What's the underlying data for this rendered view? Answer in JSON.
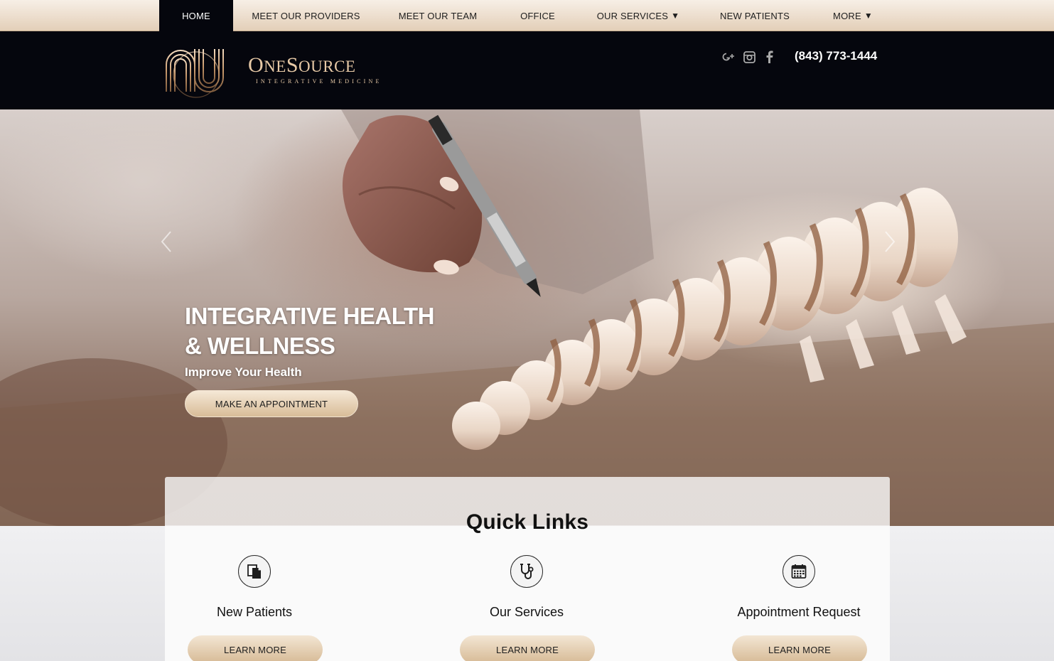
{
  "nav": {
    "items": [
      {
        "label": "HOME",
        "active": true
      },
      {
        "label": "MEET OUR PROVIDERS"
      },
      {
        "label": "MEET OUR TEAM"
      },
      {
        "label": "OFFICE"
      },
      {
        "label": "OUR SERVICES",
        "caret": "▼"
      },
      {
        "label": "NEW PATIENTS"
      },
      {
        "label": "MORE",
        "caret": "▼"
      }
    ]
  },
  "header": {
    "logo_name_first": "O",
    "logo_name_mid": "NE",
    "logo_name_s": "S",
    "logo_name_rest": "OURCE",
    "logo_sub": "INTEGRATIVE MEDICINE",
    "phone": "(843) 773-1444",
    "social_icons": [
      "google-plus-icon",
      "instagram-icon",
      "facebook-icon"
    ]
  },
  "hero": {
    "title": "INTEGRATIVE HEALTH & WELLNESS",
    "subtitle": "Improve Your Health",
    "cta": "MAKE AN APPOINTMENT"
  },
  "quick_links": {
    "title": "Quick Links",
    "items": [
      {
        "label": "New Patients",
        "icon": "documents-icon",
        "button": "LEARN MORE"
      },
      {
        "label": "Our Services",
        "icon": "stethoscope-icon",
        "button": "LEARN MORE"
      },
      {
        "label": "Appointment Request",
        "icon": "calendar-icon",
        "button": "LEARN MORE"
      }
    ]
  },
  "colors": {
    "nav_bg": "#e3cfb8",
    "header_bg": "#05060d",
    "gold": "#e7c9a6",
    "button": "#d8bc98"
  }
}
